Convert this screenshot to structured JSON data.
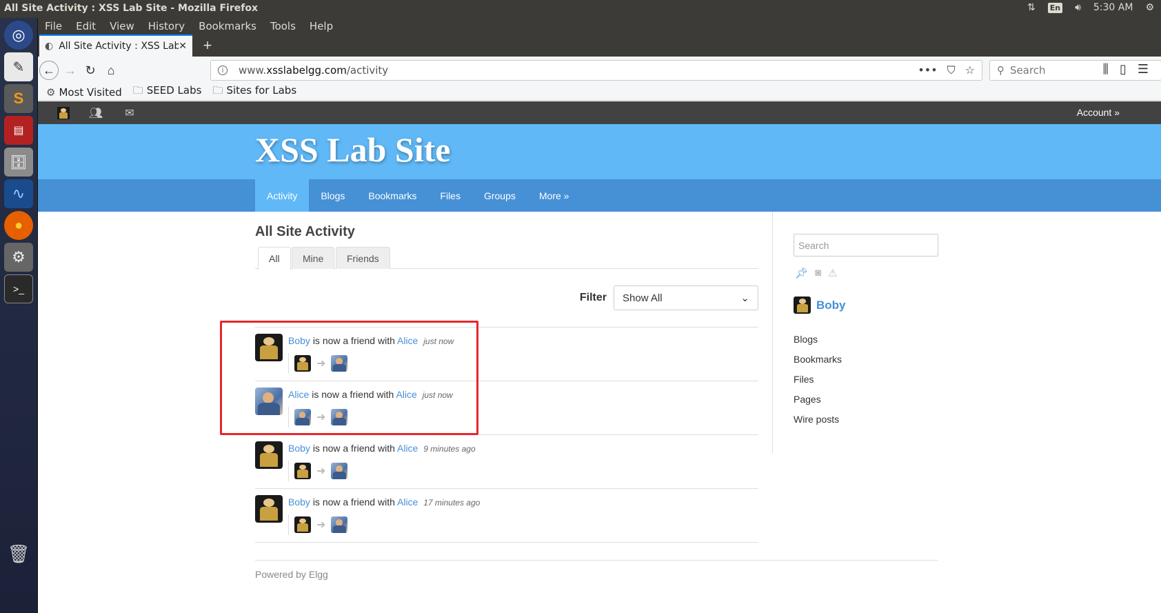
{
  "window": {
    "title": "All Site Activity : XSS Lab Site - Mozilla Firefox",
    "clock": "5:30 AM",
    "keyboard": "En"
  },
  "menubar": [
    "File",
    "Edit",
    "View",
    "History",
    "Bookmarks",
    "Tools",
    "Help"
  ],
  "tab": {
    "title": "All Site Activity : XSS Lab",
    "new_tab": "+"
  },
  "urlbar": {
    "prefix": "www.",
    "domain": "xsslabelgg.com",
    "path": "/activity",
    "search_placeholder": "Search"
  },
  "bookmarks": [
    "Most Visited",
    "SEED Labs",
    "Sites for Labs"
  ],
  "elgg": {
    "account": "Account »",
    "site_name": "XSS Lab Site",
    "nav": [
      "Activity",
      "Blogs",
      "Bookmarks",
      "Files",
      "Groups",
      "More »"
    ],
    "page_title": "All Site Activity",
    "tabs": [
      "All",
      "Mine",
      "Friends"
    ],
    "filter_label": "Filter",
    "filter_value": "Show All",
    "river": [
      {
        "subject": "Boby",
        "text": "is now a friend with",
        "object": "Alice",
        "time": "just now",
        "avatar": "boby"
      },
      {
        "subject": "Alice",
        "text": "is now a friend with",
        "object": "Alice",
        "time": "just now",
        "avatar": "alice"
      },
      {
        "subject": "Boby",
        "text": "is now a friend with",
        "object": "Alice",
        "time": "9 minutes ago",
        "avatar": "boby"
      },
      {
        "subject": "Boby",
        "text": "is now a friend with",
        "object": "Alice",
        "time": "17 minutes ago",
        "avatar": "boby"
      }
    ],
    "footer": "Powered by Elgg",
    "sidebar": {
      "search_placeholder": "Search",
      "owner": "Boby",
      "links": [
        "Blogs",
        "Bookmarks",
        "Files",
        "Pages",
        "Wire posts"
      ]
    }
  },
  "colors": {
    "header": "#60b8f7",
    "nav": "#4690d6",
    "link": "#4690d6",
    "highlight": "#e8262a"
  }
}
